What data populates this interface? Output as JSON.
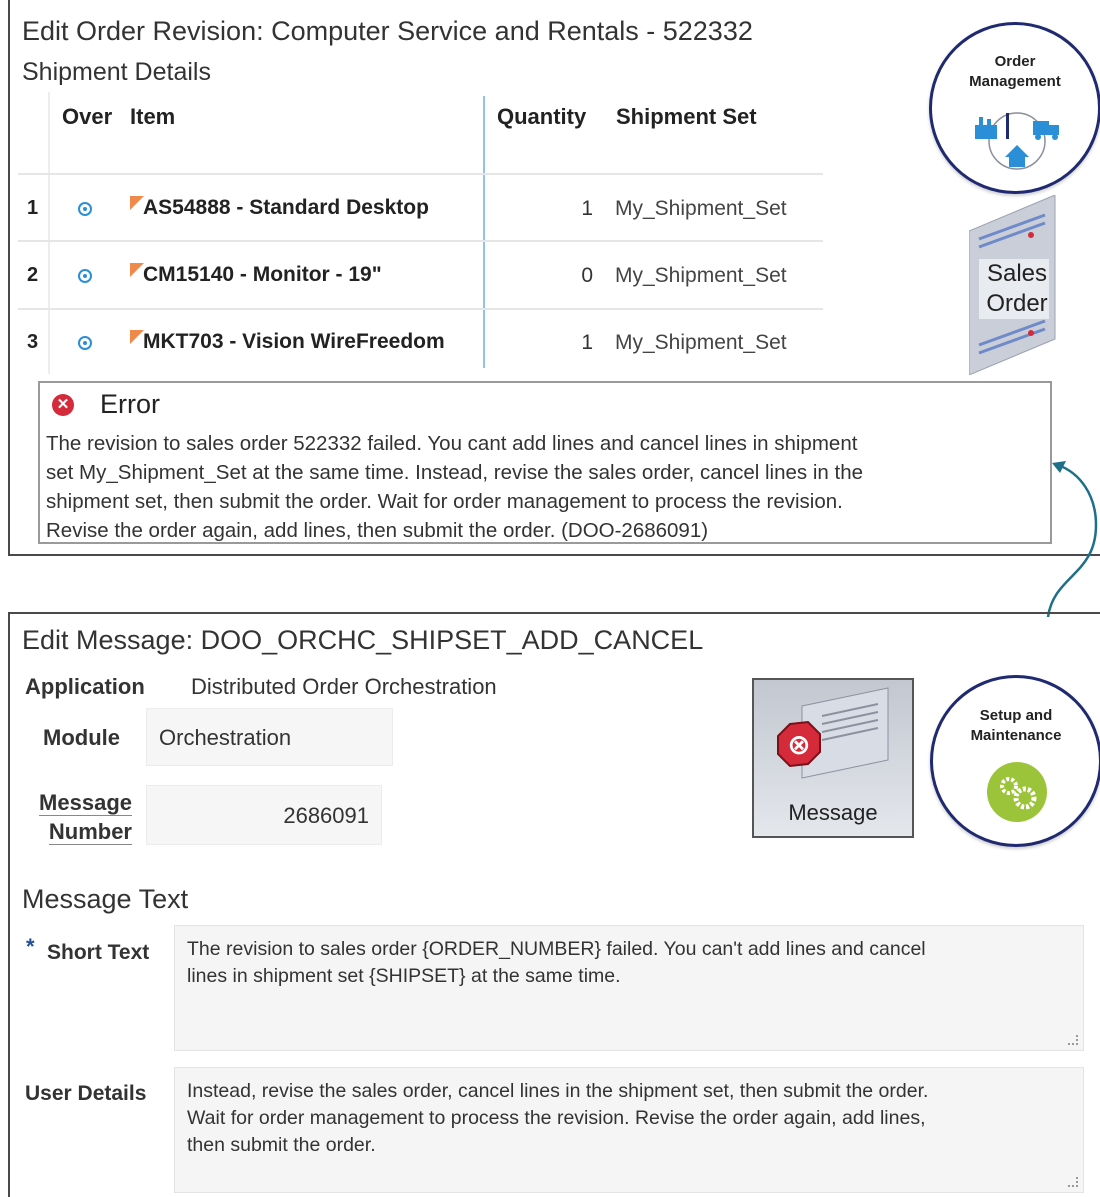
{
  "top": {
    "title": "Edit Order Revision: Computer Service and Rentals - 522332",
    "subtitle": "Shipment Details",
    "columns": {
      "over": "Over",
      "item": "Item",
      "quantity": "Quantity",
      "shipment_set": "Shipment Set"
    },
    "rows": [
      {
        "num": "1",
        "item": "AS54888 - Standard Desktop",
        "quantity": "1",
        "shipment_set": "My_Shipment_Set"
      },
      {
        "num": "2",
        "item": "CM15140 - Monitor - 19\"",
        "quantity": "0",
        "shipment_set": "My_Shipment_Set"
      },
      {
        "num": "3",
        "item": "MKT703 - Vision WireFreedom",
        "quantity": "1",
        "shipment_set": "My_Shipment_Set"
      }
    ],
    "error": {
      "title": "Error",
      "lines": [
        "The revision to sales order 522332 failed. You cant add lines and cancel lines in shipment",
        "set My_Shipment_Set at the same time. Instead, revise the sales order, cancel lines in the",
        "shipment set, then submit the order. Wait for order management to process the revision.",
        "Revise the order again, add lines, then submit the order. (DOO-2686091)"
      ]
    },
    "badge_order": {
      "line1": "Order",
      "line2": "Management"
    },
    "sales_order_icon": {
      "line1": "Sales",
      "line2": "Order"
    }
  },
  "bottom": {
    "title": "Edit Message: DOO_ORCHC_SHIPSET_ADD_CANCEL",
    "application_label": "Application",
    "application_value": "Distributed Order Orchestration",
    "module_label": "Module",
    "module_value": "Orchestration",
    "message_number_label_1": "Message",
    "message_number_label_2": "Number",
    "message_number_value": "2686091",
    "message_icon_label": "Message",
    "badge_setup": {
      "line1": "Setup and",
      "line2": "Maintenance"
    },
    "section_title": "Message Text",
    "required_mark": "*",
    "short_text_label": "Short Text",
    "short_text_lines": [
      "The revision to sales order {ORDER_NUMBER} failed. You can't add lines and cancel",
      "lines in shipment set {SHIPSET} at the same time."
    ],
    "user_details_label": "User Details",
    "user_details_lines": [
      "Instead, revise the sales order, cancel lines in the shipment set, then submit the order.",
      "Wait for order management to process the revision. Revise the order again, add lines,",
      "then submit the order."
    ]
  },
  "colors": {
    "accent": "#2a8fd6",
    "error": "#d42a3a",
    "badge_border": "#1f2a70",
    "arrow": "#1d6f8a",
    "setup_green": "#9cc43a"
  }
}
